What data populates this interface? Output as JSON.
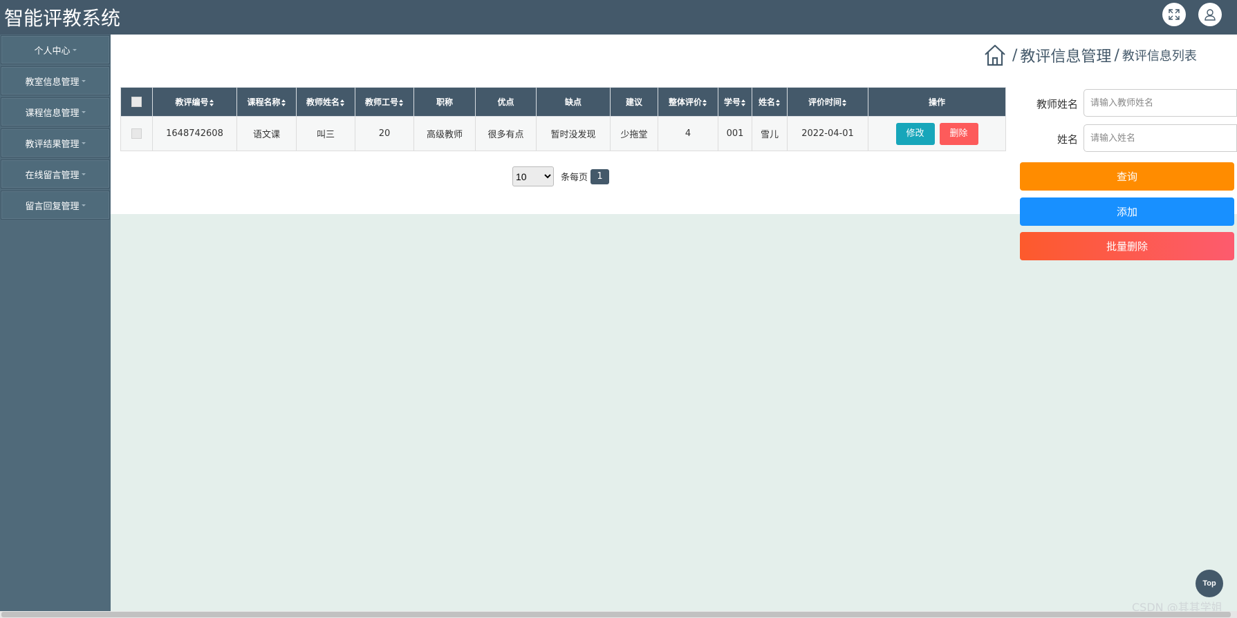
{
  "header": {
    "title": "智能评教系统",
    "fullscreen_icon": "expand-icon",
    "user_icon": "user-icon"
  },
  "sidebar": {
    "items": [
      {
        "label": "个人中心"
      },
      {
        "label": "教室信息管理"
      },
      {
        "label": "课程信息管理"
      },
      {
        "label": "教评结果管理"
      },
      {
        "label": "在线留言管理"
      },
      {
        "label": "留言回复管理"
      }
    ]
  },
  "breadcrumb": {
    "separator": "/",
    "level1": "教评信息管理",
    "level2": "教评信息列表",
    "home_icon": "home-icon"
  },
  "table": {
    "columns": [
      "教评编号",
      "课程名称",
      "教师姓名",
      "教师工号",
      "职称",
      "优点",
      "缺点",
      "建议",
      "整体评价",
      "学号",
      "姓名",
      "评价时间",
      "操作"
    ],
    "rows": [
      [
        "1648742608",
        "语文课",
        "叫三",
        "20",
        "高级教师",
        "很多有点",
        "暂时没发现",
        "少拖堂",
        "4",
        "001",
        "雪儿",
        "2022-04-01"
      ]
    ],
    "edit_label": "修改",
    "delete_label": "删除"
  },
  "pagination": {
    "page_size": "10",
    "per_page_label": "条每页",
    "current_page": "1"
  },
  "search": {
    "teacher_label": "教师姓名",
    "teacher_placeholder": "请输入教师姓名",
    "name_label": "姓名",
    "name_placeholder": "请输入姓名",
    "query_label": "查询",
    "add_label": "添加",
    "batch_delete_label": "批量删除"
  },
  "footer": {
    "top_label": "Top",
    "watermark": "CSDN @其其学姐"
  },
  "colors": {
    "header": "#44596a",
    "sidebar": "#506a7a",
    "query": "#ff8c00",
    "add": "#1890ff",
    "batch_delete": "#fd5a3a",
    "edit": "#17a6ba",
    "delete": "#fd5b5b"
  }
}
